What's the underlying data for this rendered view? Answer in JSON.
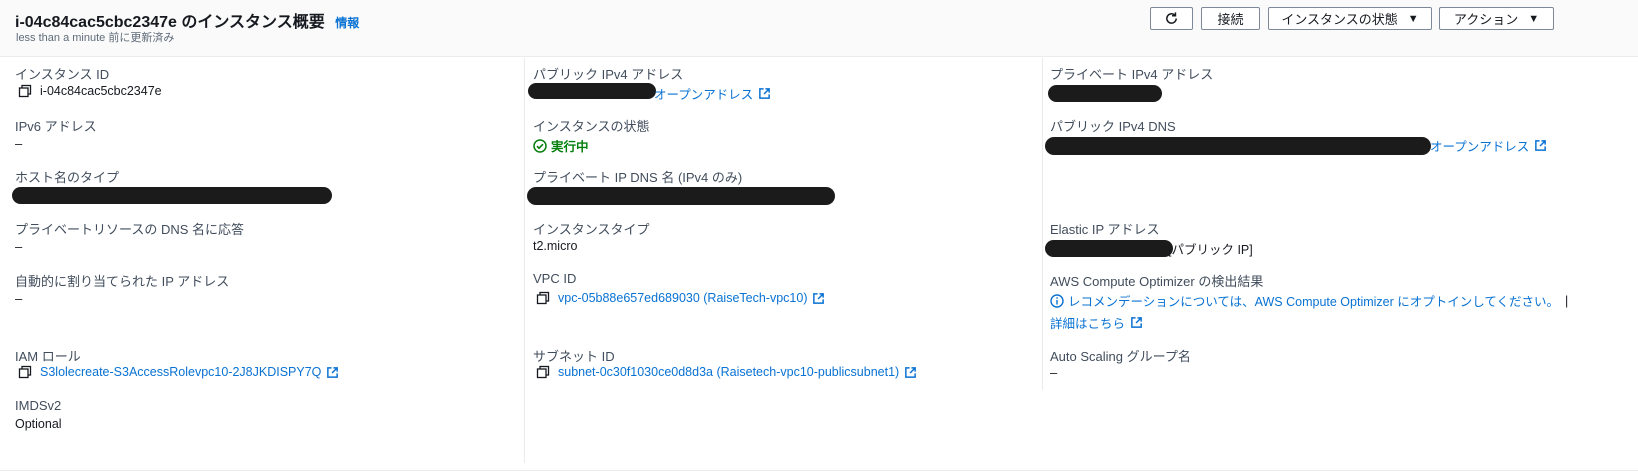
{
  "header": {
    "title": "i-04c84cac5cbc2347e のインスタンス概要",
    "info": "情報",
    "updated": "less than a minute 前に更新済み",
    "buttons": {
      "connect": "接続",
      "instance_state": "インスタンスの状態",
      "actions": "アクション"
    }
  },
  "col1": {
    "instance_id_label": "インスタンス ID",
    "instance_id": "i-04c84cac5cbc2347e",
    "ipv6_label": "IPv6 アドレス",
    "ipv6": "–",
    "hostname_type_label": "ホスト名のタイプ",
    "private_dns_label": "プライベートリソースの DNS 名に応答",
    "private_dns": "–",
    "auto_ip_label": "自動的に割り当てられた IP アドレス",
    "auto_ip": "–",
    "iam_label": "IAM ロール",
    "iam_role": "S3lolecreate-S3AccessRolevpc10-2J8JKDISPY7Q",
    "imds_label": "IMDSv2",
    "imds": "Optional"
  },
  "col2": {
    "public_ipv4_label": "パブリック IPv4 アドレス",
    "open_address": "オープンアドレス",
    "state_label": "インスタンスの状態",
    "state": "実行中",
    "private_ip_dns_label": "プライベート IP DNS 名 (IPv4 のみ)",
    "instance_type_label": "インスタンスタイプ",
    "instance_type": "t2.micro",
    "vpc_label": "VPC ID",
    "vpc_id": "vpc-05b88e657ed689030 (RaiseTech-vpc10)",
    "subnet_label": "サブネット ID",
    "subnet_id": "subnet-0c30f1030ce0d8d3a (Raisetech-vpc10-publicsubnet1)"
  },
  "col3": {
    "private_ipv4_label": "プライベート IPv4 アドレス",
    "public_dns_label": "パブリック IPv4 DNS",
    "open_address": "オープンアドレス",
    "elastic_ip_label": "Elastic IP アドレス",
    "elastic_ip_suffix": "[パブリック IP]",
    "optimizer_label": "AWS Compute Optimizer の検出結果",
    "optimizer_text": "レコメンデーションについては、AWS Compute Optimizer にオプトインしてください。",
    "optimizer_sep": "|",
    "details_link": "詳細はこちら",
    "asg_label": "Auto Scaling グループ名",
    "asg": "–"
  }
}
